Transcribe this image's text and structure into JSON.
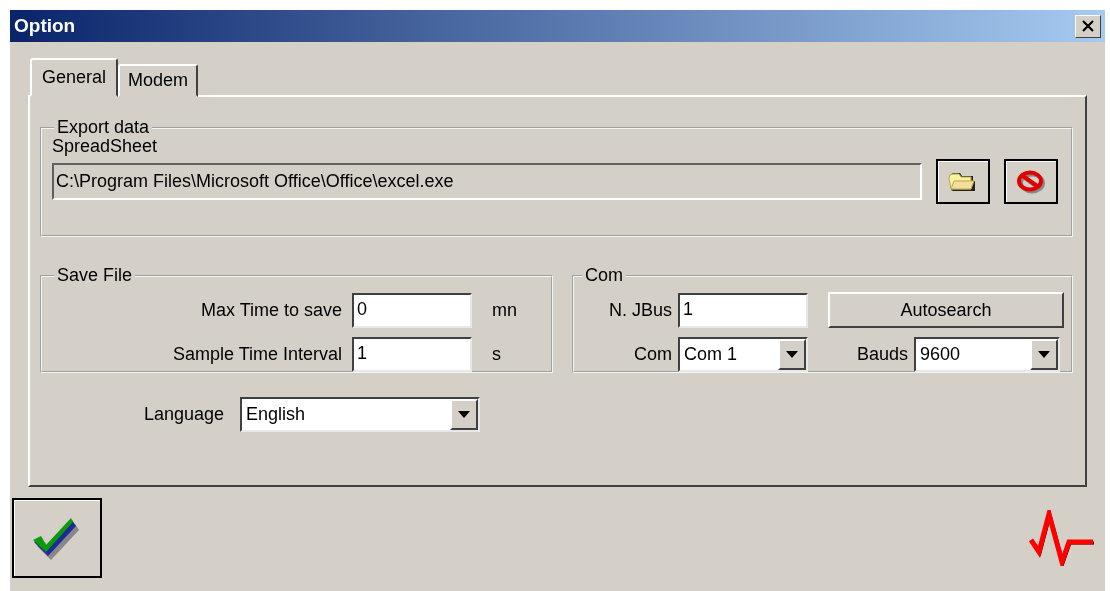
{
  "window": {
    "title": "Option"
  },
  "tabs": [
    {
      "label": "General",
      "selected": true
    },
    {
      "label": "Modem",
      "selected": false
    }
  ],
  "export_data": {
    "title": "Export data",
    "spreadsheet_label": "SpreadSheet",
    "path": "C:\\Program Files\\Microsoft Office\\Office\\excel.exe"
  },
  "save_file": {
    "title": "Save File",
    "fields": [
      {
        "label": "Max Time to save",
        "value": "0",
        "unit": "mn"
      },
      {
        "label": "Sample Time Interval",
        "value": "1",
        "unit": "s"
      }
    ]
  },
  "com": {
    "title": "Com",
    "jbus_label": "N. JBus",
    "jbus_value": "1",
    "autosearch": "Autosearch",
    "com_label": "Com",
    "com_value": "Com 1",
    "bauds_label": "Bauds",
    "bauds_value": "9600"
  },
  "language": {
    "label": "Language",
    "value": "English"
  }
}
